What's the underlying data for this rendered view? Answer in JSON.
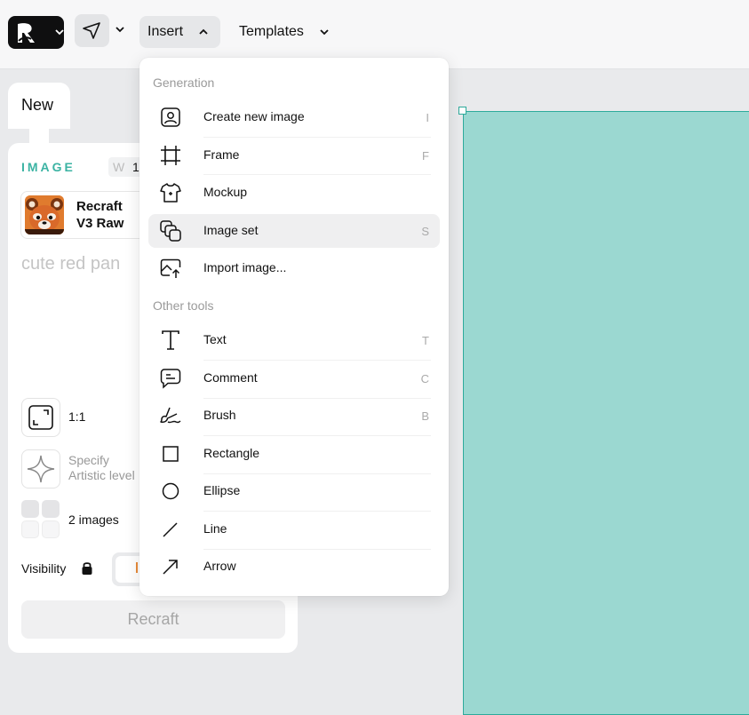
{
  "topbar": {
    "logo_icon": "recraft-logo-icon",
    "tool_icon": "pointer-arrow-icon",
    "insert_label": "Insert",
    "templates_label": "Templates"
  },
  "left_panel": {
    "new_tab_label": "New",
    "section_label": "IMAGE",
    "w_label": "W",
    "w_value": "1",
    "model": {
      "line1": "Recraft",
      "line2": "V3 Raw"
    },
    "prompt_placeholder": "cute red pan",
    "ratio_label": "1:1",
    "artistic_line1": "Specify",
    "artistic_line2": "Artistic level",
    "count_label": "2 images",
    "visibility_label": "Visibility",
    "recraft_button_label": "Recraft"
  },
  "insert_menu": {
    "generation_title": "Generation",
    "other_title": "Other tools",
    "generation_items": [
      {
        "label": "Create new image",
        "key": "I",
        "icon": "image-portrait-icon"
      },
      {
        "label": "Frame",
        "key": "F",
        "icon": "frame-icon"
      },
      {
        "label": "Mockup",
        "key": "",
        "icon": "tshirt-mockup-icon"
      },
      {
        "label": "Image set",
        "key": "S",
        "icon": "image-set-icon"
      },
      {
        "label": "Import image...",
        "key": "",
        "icon": "import-image-icon"
      }
    ],
    "other_items": [
      {
        "label": "Text",
        "key": "T",
        "icon": "text-icon"
      },
      {
        "label": "Comment",
        "key": "C",
        "icon": "comment-icon"
      },
      {
        "label": "Brush",
        "key": "B",
        "icon": "brush-icon"
      },
      {
        "label": "Rectangle",
        "key": "",
        "icon": "rectangle-icon"
      },
      {
        "label": "Ellipse",
        "key": "",
        "icon": "ellipse-icon"
      },
      {
        "label": "Line",
        "key": "",
        "icon": "line-icon"
      },
      {
        "label": "Arrow",
        "key": "",
        "icon": "arrow-icon"
      }
    ],
    "highlighted_item": "Image set"
  },
  "colors": {
    "accent_teal": "#3bb3a3",
    "canvas_fill": "#9bd8d1",
    "canvas_border": "#2eaa9b"
  }
}
